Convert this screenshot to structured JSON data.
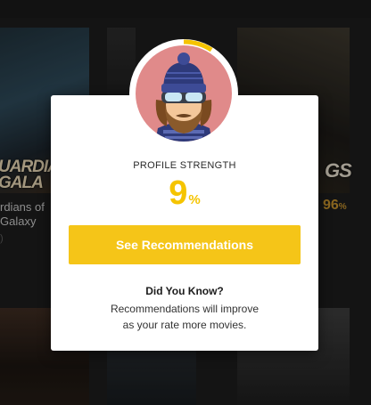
{
  "background": {
    "poster_1": {
      "text_line1": "UARDIA",
      "text_line2": "GALA"
    },
    "poster_3": {
      "text": "GS"
    },
    "movie_1": {
      "title_line1": "rdians of",
      "title_line2": "Galaxy",
      "sub": ")"
    },
    "movie_3": {
      "score": "96",
      "score_unit": "%"
    }
  },
  "modal": {
    "label": "PROFILE STRENGTH",
    "strength_value": "9",
    "strength_unit": "%",
    "strength_fraction": 0.09,
    "cta_label": "See Recommendations",
    "did_you_know_title": "Did You Know?",
    "did_you_know_line1": "Recommendations will improve",
    "did_you_know_line2": "as your rate more movies."
  },
  "colors": {
    "accent": "#f5c518",
    "progress": "#f5c400",
    "avatar_bg": "#e08a8a",
    "hat": "#2e3a7a"
  },
  "icons": {
    "avatar": "bearded-skier-avatar-icon"
  }
}
